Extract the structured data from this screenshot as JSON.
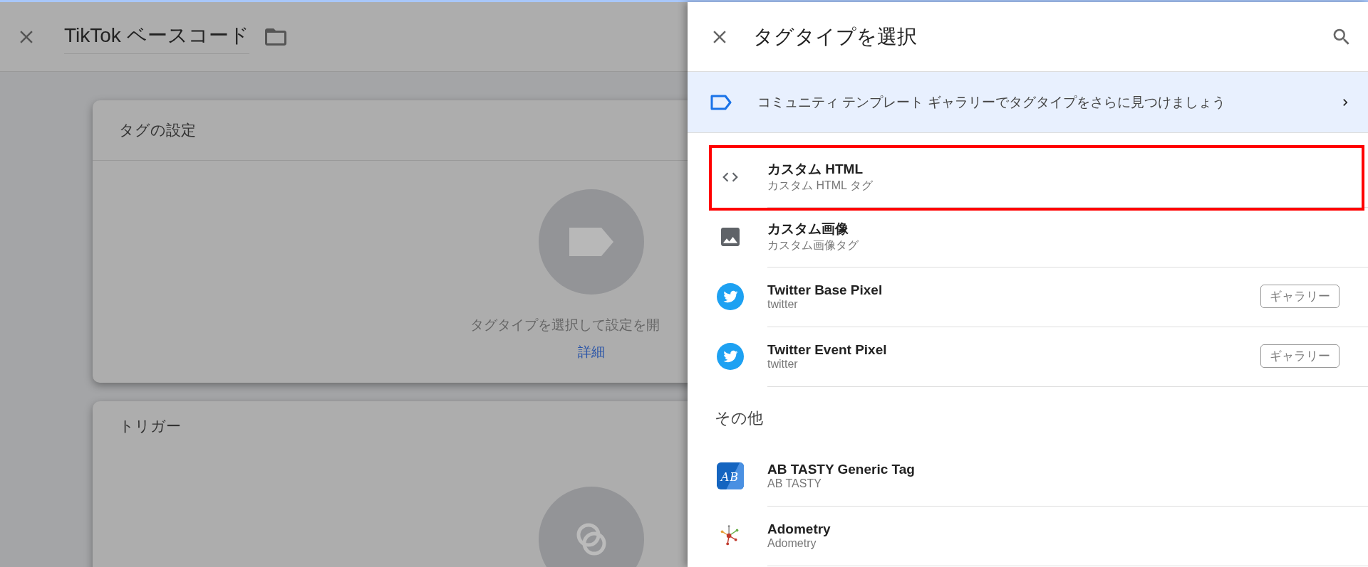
{
  "editor": {
    "title": "TikTok ベースコード",
    "cards": [
      {
        "title": "タグの設定",
        "hint": "タグタイプを選択して設定を開",
        "link": "詳細"
      },
      {
        "title": "トリガー"
      }
    ]
  },
  "panel": {
    "title": "タグタイプを選択",
    "banner": "コミュニティ テンプレート ギャラリーでタグタイプをさらに見つけましょう",
    "sections": [
      {
        "items": [
          {
            "title": "カスタム HTML",
            "subtitle": "カスタム HTML タグ",
            "highlighted": true
          },
          {
            "title": "カスタム画像",
            "subtitle": "カスタム画像タグ",
            "highlighted": false
          },
          {
            "title": "Twitter Base Pixel",
            "subtitle": "twitter",
            "badge": "ギャラリー",
            "highlighted": false
          },
          {
            "title": "Twitter Event Pixel",
            "subtitle": "twitter",
            "badge": "ギャラリー",
            "highlighted": false
          }
        ]
      },
      {
        "heading": "その他",
        "items": [
          {
            "title": "AB TASTY Generic Tag",
            "subtitle": "AB TASTY",
            "logo_text": "AB",
            "highlighted": false
          },
          {
            "title": "Adometry",
            "subtitle": "Adometry",
            "highlighted": false
          }
        ]
      }
    ]
  }
}
